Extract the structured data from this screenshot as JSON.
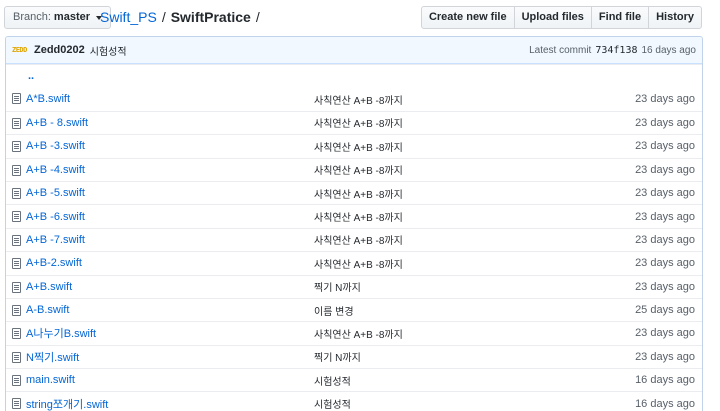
{
  "branch": {
    "label": "Branch:",
    "value": "master"
  },
  "breadcrumb": {
    "repo": "Swift_PS",
    "sep1": "/",
    "folder": "SwiftPratice",
    "sep2": "/"
  },
  "actions": {
    "create": "Create new file",
    "upload": "Upload files",
    "find": "Find file",
    "history": "History"
  },
  "commit": {
    "avatar_text": "ZEDD",
    "author": "Zedd0202",
    "message": "시험성적",
    "latest_label": "Latest commit",
    "sha": "734f138",
    "age": "16 days ago"
  },
  "parent_dir": "..",
  "files": [
    {
      "name": "A*B.swift",
      "message": "사칙연산 A+B -8까지",
      "age": "23 days ago"
    },
    {
      "name": "A+B - 8.swift",
      "message": "사칙연산 A+B -8까지",
      "age": "23 days ago"
    },
    {
      "name": "A+B -3.swift",
      "message": "사칙연산 A+B -8까지",
      "age": "23 days ago"
    },
    {
      "name": "A+B -4.swift",
      "message": "사칙연산 A+B -8까지",
      "age": "23 days ago"
    },
    {
      "name": "A+B -5.swift",
      "message": "사칙연산 A+B -8까지",
      "age": "23 days ago"
    },
    {
      "name": "A+B -6.swift",
      "message": "사칙연산 A+B -8까지",
      "age": "23 days ago"
    },
    {
      "name": "A+B -7.swift",
      "message": "사칙연산 A+B -8까지",
      "age": "23 days ago"
    },
    {
      "name": "A+B-2.swift",
      "message": "사칙연산 A+B -8까지",
      "age": "23 days ago"
    },
    {
      "name": "A+B.swift",
      "message": "찍기 N까지",
      "age": "23 days ago"
    },
    {
      "name": "A-B.swift",
      "message": "이름 변경",
      "age": "25 days ago"
    },
    {
      "name": "A나누기B.swift",
      "message": "사칙연산 A+B -8까지",
      "age": "23 days ago"
    },
    {
      "name": "N찍기.swift",
      "message": "찍기 N까지",
      "age": "23 days ago"
    },
    {
      "name": "main.swift",
      "message": "시험성적",
      "age": "16 days ago"
    },
    {
      "name": "string쪼개기.swift",
      "message": "시험성적",
      "age": "16 days ago"
    }
  ]
}
